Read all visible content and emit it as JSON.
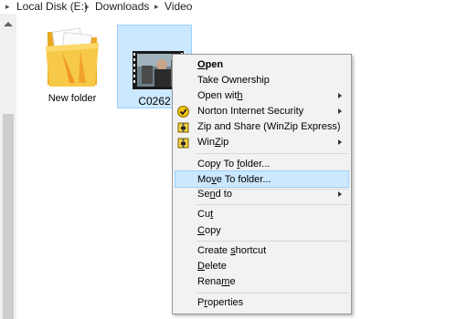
{
  "breadcrumb": {
    "items": [
      "Local Disk (E:)",
      "Downloads",
      "Video"
    ]
  },
  "files": {
    "folder": {
      "label": "New folder"
    },
    "video": {
      "label": "C0262"
    }
  },
  "menu": {
    "open": {
      "pre": "",
      "key": "O",
      "post": "pen"
    },
    "take_ownership": "Take Ownership",
    "open_with": {
      "pre": "Open wit",
      "key": "h",
      "post": ""
    },
    "norton": "Norton Internet Security",
    "zip_share": "Zip and Share (WinZip Express)",
    "winzip": {
      "pre": "Win",
      "key": "Z",
      "post": "ip"
    },
    "copy_to_folder": {
      "pre": "Copy To ",
      "key": "f",
      "post": "older..."
    },
    "move_to_folder": {
      "pre": "Mo",
      "key": "v",
      "post": "e To folder..."
    },
    "send_to": {
      "pre": "Se",
      "key": "n",
      "post": "d to"
    },
    "cut": {
      "pre": "Cu",
      "key": "t",
      "post": ""
    },
    "copy": {
      "pre": "",
      "key": "C",
      "post": "opy"
    },
    "create_shortcut": {
      "pre": "Create ",
      "key": "s",
      "post": "hortcut"
    },
    "delete": {
      "pre": "",
      "key": "D",
      "post": "elete"
    },
    "rename": {
      "pre": "Rena",
      "key": "m",
      "post": "e"
    },
    "properties": {
      "pre": "P",
      "key": "r",
      "post": "operties"
    }
  },
  "colors": {
    "selection": "#cce8ff",
    "selection_border": "#99d1ff",
    "menu_bg": "#f2f2f2",
    "folder": "#f5c242"
  }
}
